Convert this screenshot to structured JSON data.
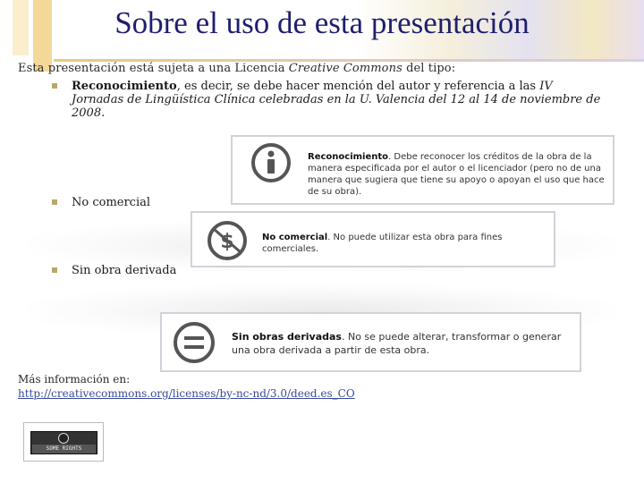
{
  "header": {
    "title": "Sobre el uso de esta presentación"
  },
  "intro": {
    "prefix": "Esta presentación está sujeta a una Licencia ",
    "license_name": "Creative Commons",
    "suffix": " del tipo:"
  },
  "bullets": [
    {
      "bold": "Reconocimiento",
      "text_a": ", es decir, se debe hacer mención del autor y referencia a las ",
      "italic": "IV Jornadas de Lingüística Clínica celebradas en la U. Valencia del 12 al 14 de noviembre de 2008."
    },
    {
      "label": "No comercial"
    },
    {
      "label": "Sin obra derivada"
    }
  ],
  "cards": {
    "by": {
      "title": "Reconocimiento",
      "text": ". Debe reconocer los créditos de la obra de la manera especificada por el autor o el licenciador (pero no de una manera que sugiera que tiene su apoyo o apoyan el uso que hace de su obra).",
      "icon": "attribution-icon"
    },
    "nc": {
      "title": "No comercial",
      "text": ". No puede utilizar esta obra para fines comerciales.",
      "icon": "noncommercial-icon"
    },
    "nd": {
      "title": "Sin obras derivadas",
      "text": ". No se puede alterar, transformar o generar una obra derivada a partir de esta obra.",
      "icon": "noderivatives-icon"
    }
  },
  "footer": {
    "more_label": "Más información en:",
    "link": "http://creativecommons.org/licenses/by-nc-nd/3.0/deed.es_CO",
    "badge_text": "SOME RIGHTS RESERVED",
    "badge_icon": "cc-icon"
  }
}
